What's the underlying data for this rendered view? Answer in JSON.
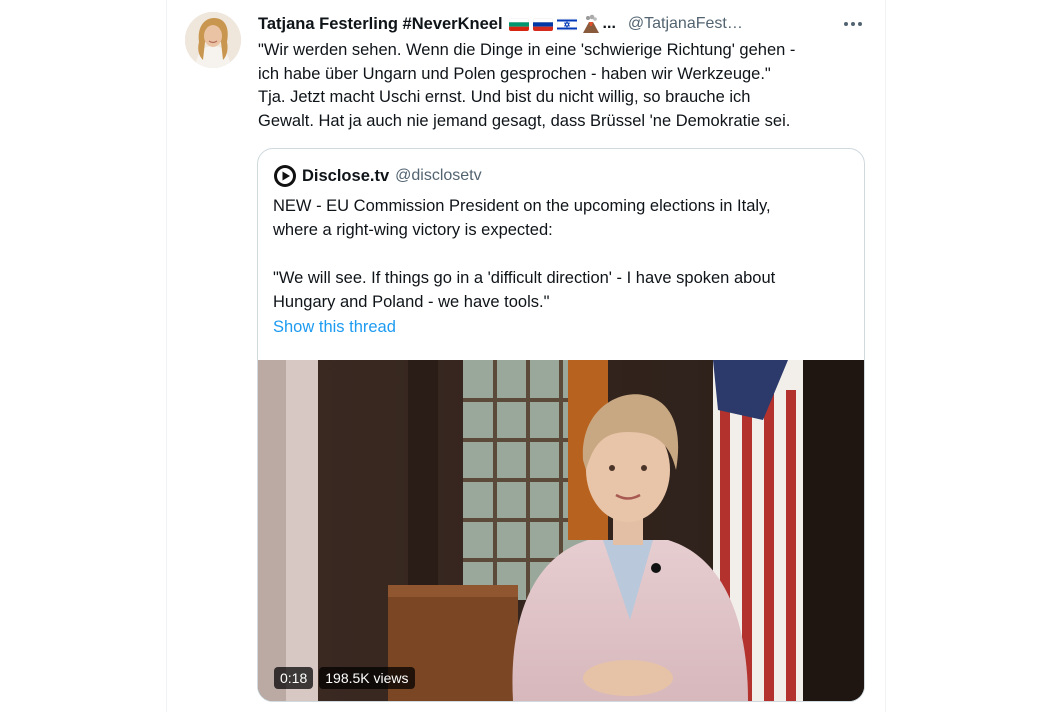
{
  "tweet": {
    "display_name": "Tatjana Festerling #NeverKneel",
    "name_overflow": "...",
    "handle": "@TatjanaFest…",
    "more_icon": "more-horizontal-icon",
    "text_lines": [
      "\"Wir werden sehen. Wenn die Dinge in eine 'schwierige Richtung' gehen -",
      "ich habe über Ungarn und Polen gesprochen - haben wir Werkzeuge.\"",
      "Tja. Jetzt macht Uschi ernst. Und bist du nicht willig, so brauche ich",
      "Gewalt. Hat ja auch nie jemand gesagt, dass Brüssel 'ne Demokratie sei."
    ],
    "emoji_flags": [
      "bulgaria-flag-icon",
      "russia-flag-icon",
      "israel-flag-icon",
      "volcano-icon"
    ]
  },
  "quoted": {
    "display_name": "Disclose.tv",
    "handle": "@disclosetv",
    "text_lines": [
      "NEW - EU Commission President on the upcoming elections in Italy,",
      "where a right-wing victory is expected:",
      "",
      "\"We will see. If things go in a 'difficult direction' - I have spoken about",
      "Hungary and Poland - we have tools.\""
    ],
    "show_thread": "Show this thread",
    "video": {
      "duration": "0:18",
      "views": "198.5K views"
    }
  },
  "colors": {
    "link": "#1d9bf0",
    "secondary_text": "#536471",
    "border": "#cfd9de"
  }
}
